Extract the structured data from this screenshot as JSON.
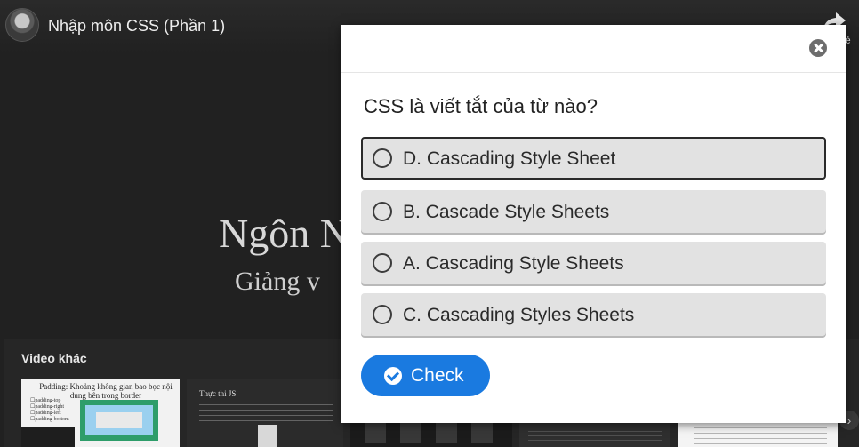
{
  "player": {
    "title": "Nhập môn CSS (Phần 1)",
    "share_label": "ẻ",
    "slide_title": "Ngôn N",
    "slide_subtitle": "Giảng v",
    "more_videos_label": "Video khác",
    "thumbnails": [
      {
        "title": "Padding: Khoảng không gian bao bọc nội dung bên trong border",
        "items": [
          "☐padding-top",
          "☐padding-right",
          "☐padding-left",
          "☐padding-bottom"
        ]
      },
      {
        "title": "Thực thi JS"
      },
      {
        "title": ""
      },
      {
        "title": ""
      },
      {
        "title": ""
      }
    ],
    "next_icon": "chevron-right-icon"
  },
  "quiz": {
    "question": "CSS là viết tắt của từ nào?",
    "options": [
      {
        "label": "D. Cascading Style Sheet",
        "selected": true
      },
      {
        "label": "B. Cascade Style Sheets",
        "selected": false
      },
      {
        "label": "A. Cascading Style Sheets",
        "selected": false
      },
      {
        "label": "C. Cascading Styles Sheets",
        "selected": false
      }
    ],
    "check_label": "Check",
    "close_icon": "close-icon",
    "accent_color": "#1a7ae0"
  }
}
